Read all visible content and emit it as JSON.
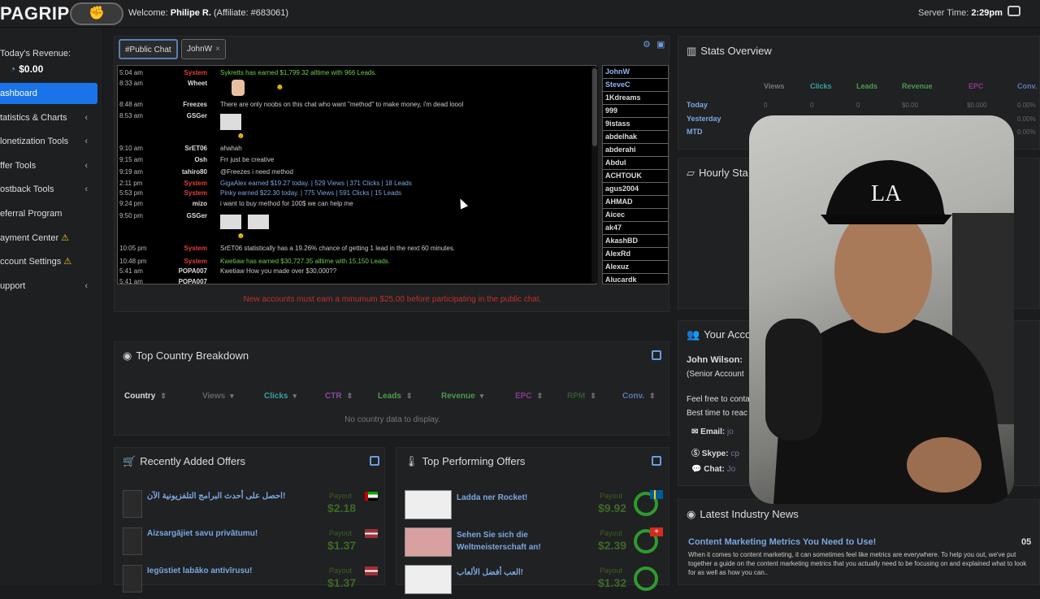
{
  "header": {
    "logo": "PAGRIP",
    "welcome_prefix": "Welcome: ",
    "user_name": "Philipe R.",
    "affiliate": " (Affiliate: #683061)",
    "server_time_label": "Server Time: ",
    "server_time": "2:29pm"
  },
  "sidebar": {
    "revenue_label": "Today's Revenue:",
    "revenue_value": "$0.00",
    "items": [
      {
        "label": "ashboard"
      },
      {
        "label": "tatistics & Charts"
      },
      {
        "label": "lonetization Tools"
      },
      {
        "label": "ffer Tools"
      },
      {
        "label": "ostback Tools"
      },
      {
        "label": "eferral Program"
      },
      {
        "label": "ayment Center"
      },
      {
        "label": "ccount Settings"
      },
      {
        "label": "upport"
      }
    ]
  },
  "chat": {
    "tabs": [
      "#Public Chat",
      "JohnW"
    ],
    "messages": [
      {
        "time": "5:04 am",
        "user": "System",
        "text": "Sykretts has earned $1,799.32 alltime with 966 Leads."
      },
      {
        "time": "8:33 am",
        "user": "Wheet",
        "text": ""
      },
      {
        "time": "8:48 am",
        "user": "Freezes",
        "text": "There are only noobs on this chat who want \"method\" to make money, i'm dead loool"
      },
      {
        "time": "8:53 am",
        "user": "GSGer",
        "text": ""
      },
      {
        "time": "9:10 am",
        "user": "SrET06",
        "text": "ahahah"
      },
      {
        "time": "9:15 am",
        "user": "Osh",
        "text": "Frr just be creative"
      },
      {
        "time": "9:19 am",
        "user": "tahiro80",
        "text": "@Freezes i need method"
      },
      {
        "time": "2:11 pm",
        "user": "System",
        "text": "GigaAlex earned $19.27 today. | 529 Views | 371 Clicks | 18 Leads"
      },
      {
        "time": "5:53 pm",
        "user": "System",
        "text": "Pinky earned $22.30 today. | 775 Views | 591 Clicks | 15 Leads"
      },
      {
        "time": "9:24 pm",
        "user": "mizo",
        "text": "i want to buy method for 100$ we can help me"
      },
      {
        "time": "9:50 pm",
        "user": "GSGer",
        "text": ""
      },
      {
        "time": "10:05 pm",
        "user": "System",
        "text": "SrET06 statistically has a 19.26% chance of getting 1 lead in the next 60 minutes."
      },
      {
        "time": "10:48 pm",
        "user": "System",
        "text": "Kwetiaw has earned $30,727.35 alltime with 15,150 Leads."
      },
      {
        "time": "5:41 am",
        "user": "POPA007",
        "text": "Kwetiaw How you made over $30,000??"
      },
      {
        "time": "5:41 am",
        "user": "POPA007",
        "text": ""
      }
    ],
    "users": [
      "JohnW",
      "SteveC",
      "1Kdreams",
      "999",
      "9istass",
      "abdelhak",
      "abderahi",
      "Abdul",
      "ACHTOUK",
      "agus2004",
      "AHMAD",
      "Aicec",
      "ak47",
      "AkashBD",
      "AlexRd",
      "Alexuz",
      "Alucardk"
    ],
    "note": "New accounts must earn a minumum $25.00 before participating in the public chat."
  },
  "country": {
    "title": "Top Country Breakdown",
    "columns": [
      "Country",
      "Views",
      "Clicks",
      "CTR",
      "Leads",
      "Revenue",
      "EPC",
      "RPM",
      "Conv."
    ],
    "empty": "No country data to display."
  },
  "recent_offers": {
    "title": "Recently Added Offers",
    "payout_label": "Payout",
    "items": [
      {
        "name": "احصل على أحدث البرامج التلفزيونية الآن!",
        "payout": "$2.18"
      },
      {
        "name": "Aizsargājiet savu privātumu!",
        "payout": "$1.37"
      },
      {
        "name": "Iegūstiet labāko antivīrusu!",
        "payout": "$1.37"
      }
    ]
  },
  "top_offers": {
    "title": "Top Performing Offers",
    "payout_label": "Payout",
    "items": [
      {
        "name": "Ladda ner Rocket!",
        "payout": "$9.92"
      },
      {
        "name": "Sehen Sie sich die Weltmeisterschaft an!",
        "payout": "$2.39"
      },
      {
        "name": "العب أفضل الألعاب!",
        "payout": "$1.32"
      }
    ]
  },
  "stats": {
    "title": "Stats Overview",
    "columns": [
      "Views",
      "Clicks",
      "Leads",
      "Revenue",
      "EPC",
      "Conv."
    ],
    "rows": [
      {
        "label": "Today",
        "values": [
          "0",
          "0",
          "0",
          "$0.00",
          "$0.000",
          "0.00%"
        ]
      },
      {
        "label": "Yesterday",
        "values": [
          "",
          "",
          "",
          "",
          "",
          "0.00%"
        ]
      },
      {
        "label": "MTD",
        "values": [
          "",
          "",
          "",
          "",
          "",
          "0.00%"
        ]
      }
    ]
  },
  "hourly": {
    "title": "Hourly Sta"
  },
  "account": {
    "title": "Your Acco",
    "manager": "John Wilson:",
    "role": "(Senior Account",
    "line1": "Feel free to conta",
    "line2": "Best time to reac",
    "email_label": "Email:",
    "email": "jo",
    "skype_label": "Skype:",
    "skype": "cp",
    "chat_label": "Chat:",
    "chat": "Jo"
  },
  "news": {
    "title": "Latest Industry News",
    "headline": "Content Marketing Metrics You Need to Use!",
    "number": "05",
    "body": "When it comes to content marketing, it can sometimes feel like metrics are everywhere. To help you out, we've put together a guide on the content marketing metrics that you actually need to be focusing on and explained what to look for as well as how you can.."
  },
  "colors": {
    "accent": "#1a73e8",
    "link": "#7aa7e0",
    "system": "#e0403a",
    "earned": "#6fcf4a"
  }
}
